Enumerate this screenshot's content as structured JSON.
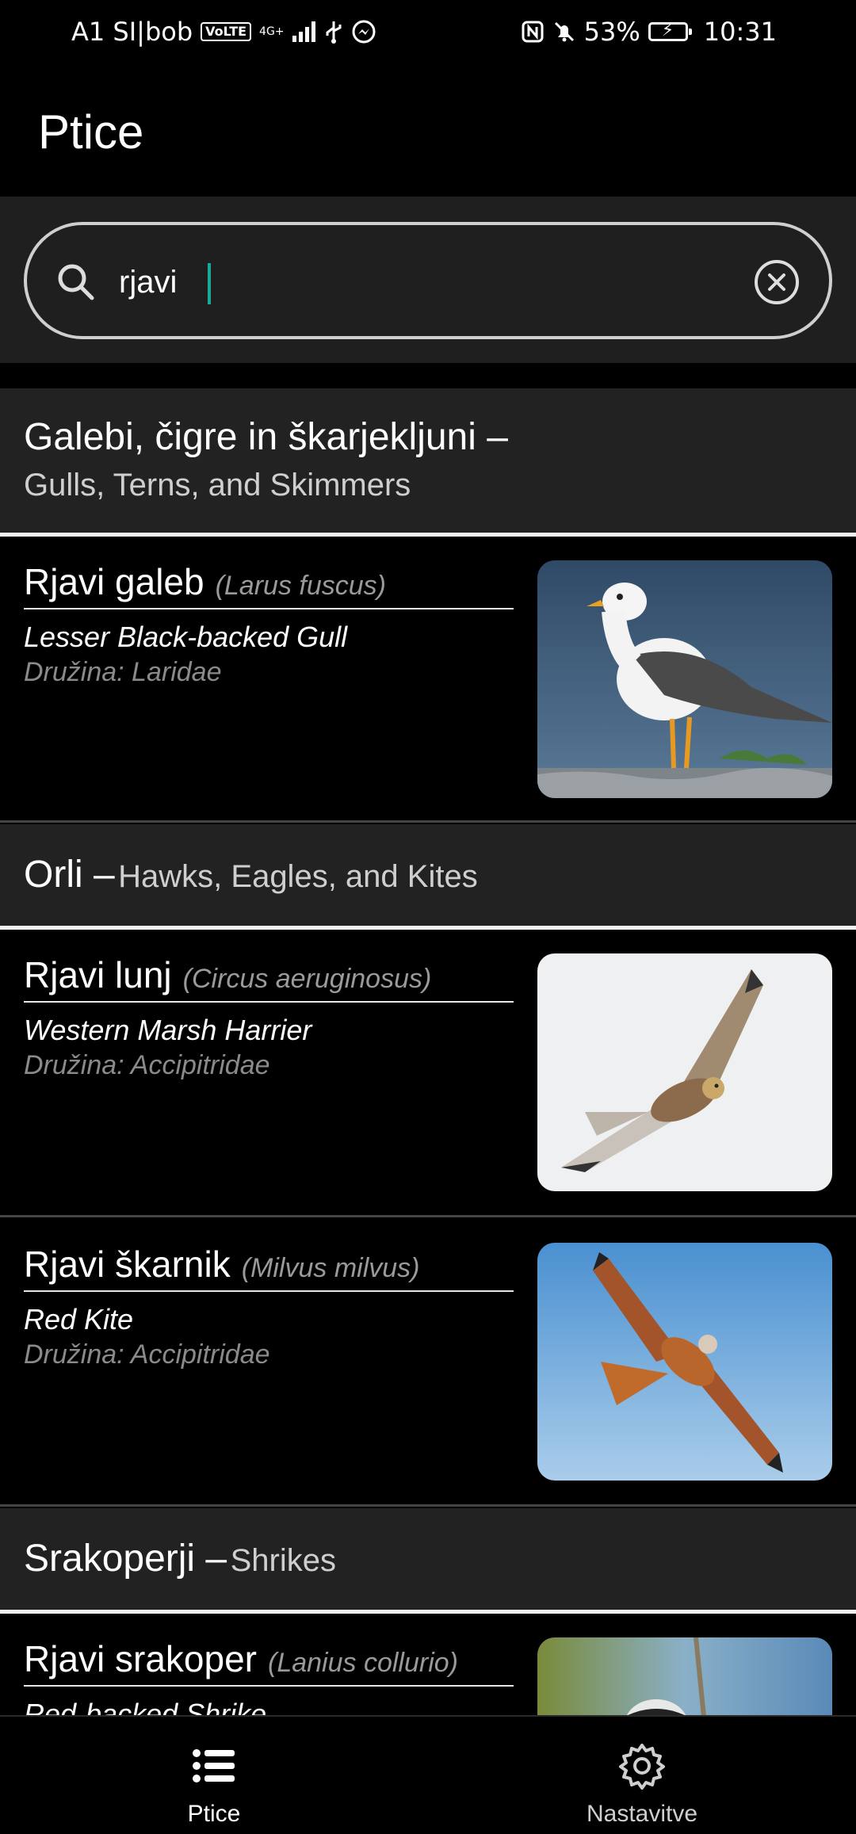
{
  "status_bar": {
    "carrier": "A1 SI|bob",
    "volte": "VoLTE",
    "network": "4G+",
    "battery": "53%",
    "time": "10:31"
  },
  "app_bar": {
    "title": "Ptice"
  },
  "search": {
    "value": "rjavi",
    "placeholder": ""
  },
  "groups": [
    {
      "name_sl": "Galebi, čigre in škarjekljuni –",
      "name_en": "Gulls, Terns, and Skimmers",
      "birds": [
        {
          "name": "Rjavi galeb",
          "latin": "(Larus fuscus)",
          "english": "Lesser Black-backed Gull",
          "family": "Družina: Laridae",
          "photo": "gull"
        }
      ]
    },
    {
      "name_sl": "Orli –",
      "name_en": "Hawks, Eagles, and Kites",
      "birds": [
        {
          "name": "Rjavi lunj",
          "latin": "(Circus aeruginosus)",
          "english": "Western Marsh Harrier",
          "family": "Družina: Accipitridae",
          "photo": "harrier"
        },
        {
          "name": "Rjavi škarnik",
          "latin": "(Milvus milvus)",
          "english": "Red Kite",
          "family": "Družina: Accipitridae",
          "photo": "kite"
        }
      ]
    },
    {
      "name_sl": "Srakoperji –",
      "name_en": "Shrikes",
      "birds": [
        {
          "name": "Rjavi srakoper",
          "latin": "(Lanius collurio)",
          "english": "Red-backed Shrike",
          "family": "",
          "photo": "shrike"
        }
      ]
    }
  ],
  "bottom_nav": {
    "items": [
      {
        "label": "Ptice",
        "icon": "list-icon"
      },
      {
        "label": "Nastavitve",
        "icon": "gear-icon"
      }
    ]
  }
}
